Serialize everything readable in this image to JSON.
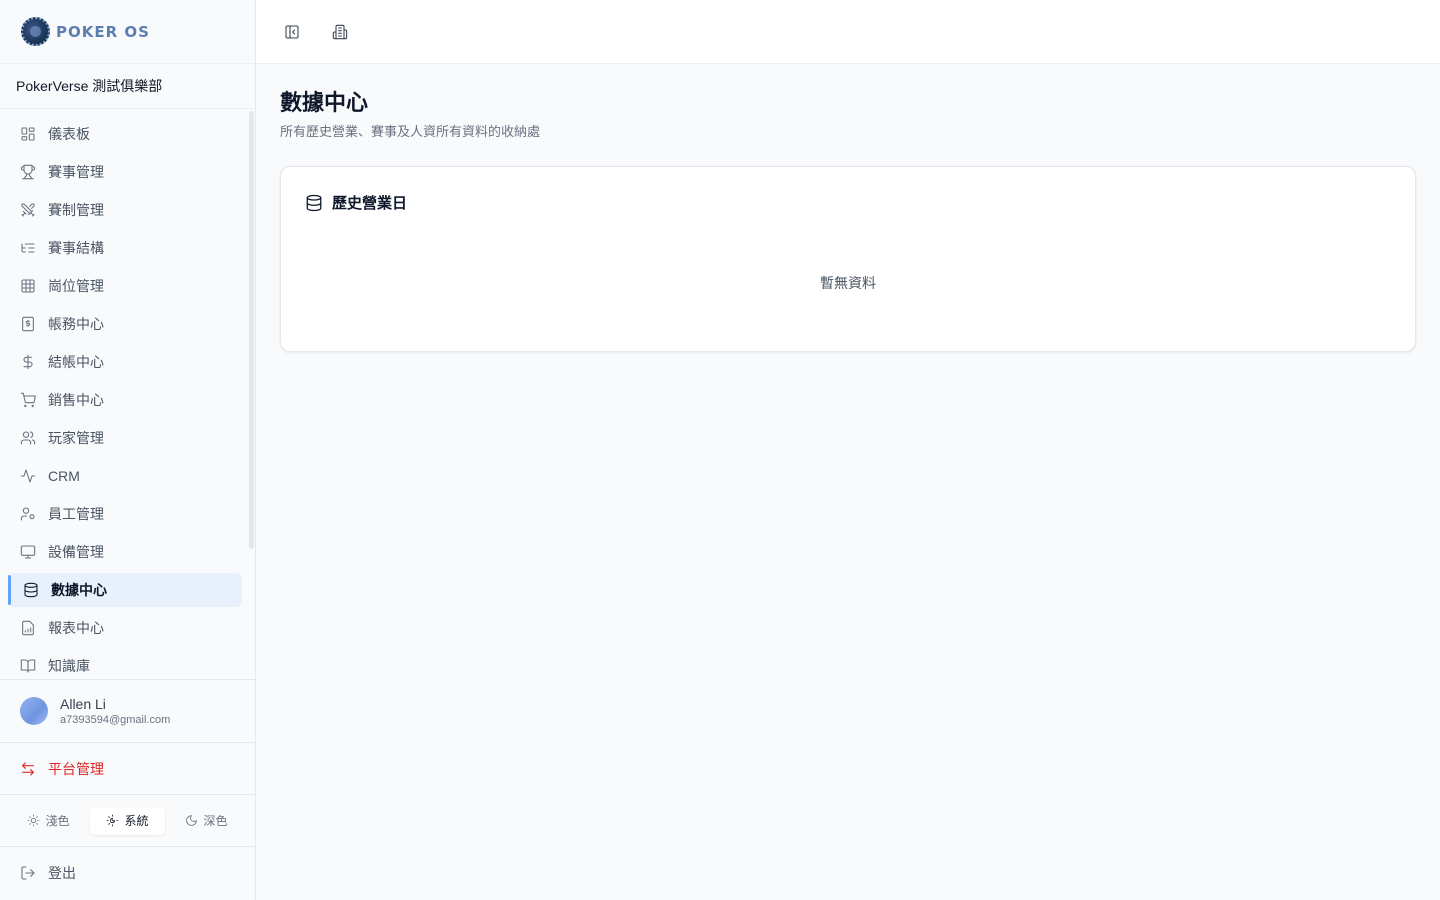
{
  "brand": {
    "logo_text": "POKER OS",
    "club_name": "PokerVerse 測試俱樂部"
  },
  "nav": {
    "items": [
      {
        "label": "儀表板",
        "icon": "layout-grid-icon"
      },
      {
        "label": "賽事管理",
        "icon": "trophy-icon"
      },
      {
        "label": "賽制管理",
        "icon": "swords-icon"
      },
      {
        "label": "賽事結構",
        "icon": "list-tree-icon"
      },
      {
        "label": "崗位管理",
        "icon": "table-grid-icon"
      },
      {
        "label": "帳務中心",
        "icon": "receipt-icon"
      },
      {
        "label": "結帳中心",
        "icon": "dollar-icon"
      },
      {
        "label": "銷售中心",
        "icon": "cart-icon"
      },
      {
        "label": "玩家管理",
        "icon": "users-icon"
      },
      {
        "label": "CRM",
        "icon": "activity-icon"
      },
      {
        "label": "員工管理",
        "icon": "user-cog-icon"
      },
      {
        "label": "設備管理",
        "icon": "monitor-icon"
      },
      {
        "label": "數據中心",
        "icon": "database-icon",
        "active": true
      },
      {
        "label": "報表中心",
        "icon": "file-chart-icon"
      },
      {
        "label": "知識庫",
        "icon": "book-icon"
      }
    ]
  },
  "user": {
    "name": "Allen Li",
    "email": "a7393594@gmail.com"
  },
  "platform": {
    "label": "平台管理"
  },
  "theme": {
    "light": "淺色",
    "system": "系統",
    "dark": "深色",
    "selected": "system"
  },
  "logout": {
    "label": "登出"
  },
  "page": {
    "title": "數據中心",
    "subtitle": "所有歷史營業、賽事及人資所有資料的收納處"
  },
  "card": {
    "title": "歷史營業日",
    "empty_text": "暫無資料"
  },
  "colors": {
    "accent": "#60a5fa",
    "active_bg": "#e8f0fb",
    "danger": "#dc2626"
  }
}
